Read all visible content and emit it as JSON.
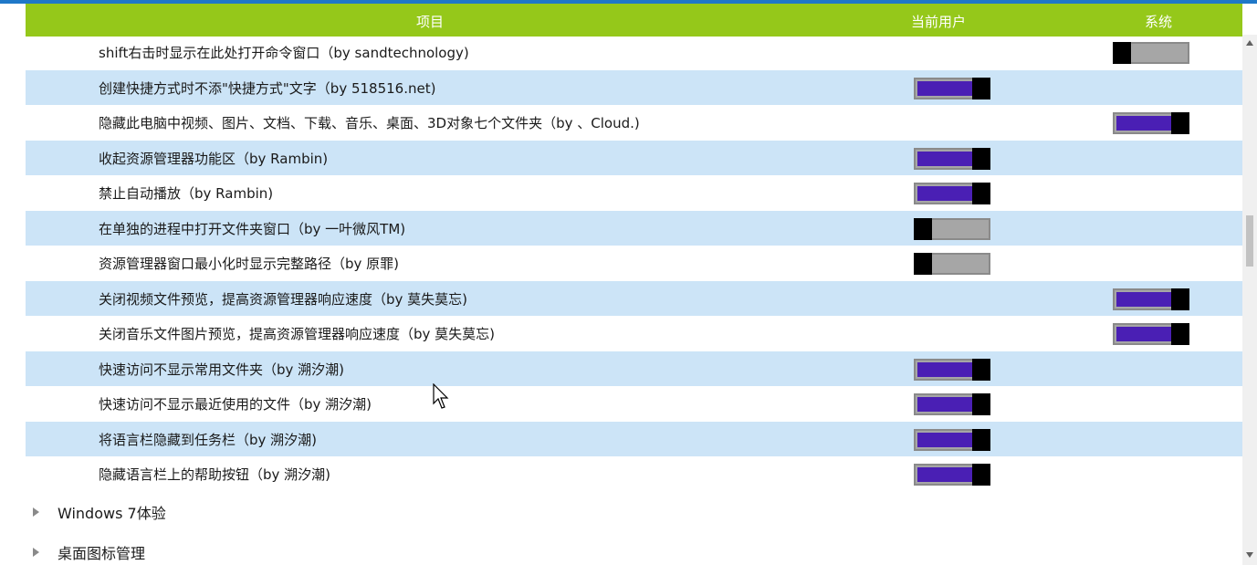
{
  "header": {
    "item": "项目",
    "current_user": "当前用户",
    "system": "系统"
  },
  "rows": [
    {
      "label": "shift右击时显示在此处打开命令窗口（by sandtechnology)",
      "user": null,
      "system": "off"
    },
    {
      "label": "创建快捷方式时不添\"快捷方式\"文字（by 518516.net)",
      "user": "on",
      "system": null
    },
    {
      "label": "隐藏此电脑中视频、图片、文档、下载、音乐、桌面、3D对象七个文件夹（by 、Cloud.)",
      "user": null,
      "system": "on"
    },
    {
      "label": "收起资源管理器功能区（by Rambin)",
      "user": "on",
      "system": null
    },
    {
      "label": "禁止自动播放（by Rambin)",
      "user": "on",
      "system": null
    },
    {
      "label": "在单独的进程中打开文件夹窗口（by 一叶微风TM)",
      "user": "off",
      "system": null
    },
    {
      "label": "资源管理器窗口最小化时显示完整路径（by 原罪)",
      "user": "off",
      "system": null
    },
    {
      "label": "关闭视频文件预览，提高资源管理器响应速度（by 莫失莫忘)",
      "user": null,
      "system": "on"
    },
    {
      "label": "关闭音乐文件图片预览，提高资源管理器响应速度（by 莫失莫忘)",
      "user": null,
      "system": "on"
    },
    {
      "label": "快速访问不显示常用文件夹（by 溯汐潮)",
      "user": "on",
      "system": null
    },
    {
      "label": "快速访问不显示最近使用的文件（by 溯汐潮)",
      "user": "on",
      "system": null
    },
    {
      "label": "将语言栏隐藏到任务栏（by 溯汐潮)",
      "user": "on",
      "system": null
    },
    {
      "label": "隐藏语言栏上的帮助按钮（by 溯汐潮)",
      "user": "on",
      "system": null
    }
  ],
  "groups": {
    "win7": "Windows 7体验",
    "desktop": "桌面图标管理"
  },
  "colors": {
    "header_bg": "#95c81a",
    "row_alt_bg": "#cce4f7",
    "toggle_on": "#4a1fb4",
    "toggle_off": "#a6a6a6",
    "toggle_thumb": "#000000"
  }
}
